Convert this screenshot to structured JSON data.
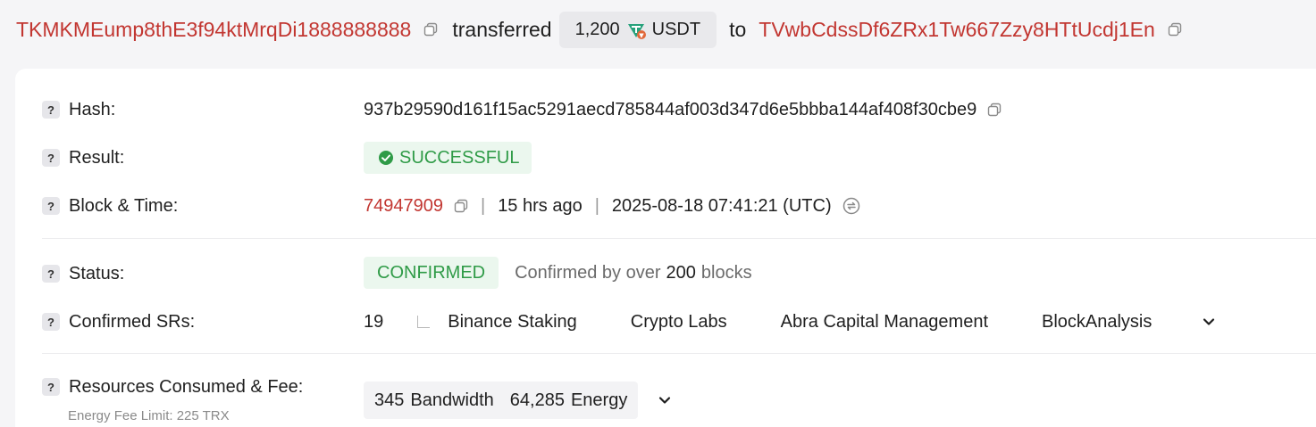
{
  "header": {
    "from_address": "TKMKMEump8thE3f94ktMrqDi1888888888",
    "transferred_word": "transferred",
    "amount": "1,200",
    "token_symbol": "USDT",
    "to_word": "to",
    "to_address": "TVwbCdssDf6ZRx1Tw667Zzy8HTtUcdj1En"
  },
  "hash": {
    "label": "Hash:",
    "value": "937b29590d161f15ac5291aecd785844af003d347d6e5bbba144af408f30cbe9"
  },
  "result": {
    "label": "Result:",
    "value": "SUCCESSFUL"
  },
  "block_time": {
    "label": "Block & Time:",
    "block": "74947909",
    "sep": "|",
    "age": "15 hrs ago",
    "datetime": "2025-08-18 07:41:21 (UTC)"
  },
  "status": {
    "label": "Status:",
    "value": "CONFIRMED",
    "confirmed_prefix": "Confirmed by over",
    "confirmed_count": "200",
    "confirmed_suffix": "blocks"
  },
  "confirmed_srs": {
    "label": "Confirmed SRs:",
    "count": "19",
    "names": [
      "Binance Staking",
      "Crypto Labs",
      "Abra Capital Management",
      "BlockAnalysis"
    ]
  },
  "resources": {
    "label": "Resources Consumed & Fee:",
    "sub_label": "Energy Fee Limit: 225 TRX",
    "bandwidth_value": "345",
    "bandwidth_label": "Bandwidth",
    "energy_value": "64,285",
    "energy_label": "Energy"
  },
  "colors": {
    "accent_red": "#c23631",
    "success_green": "#2f9b47",
    "success_bg": "#ebf7ee"
  },
  "icons": [
    "copy-icon",
    "usdt-token-icon",
    "check-circle-icon",
    "convert-time-icon",
    "chevron-down-icon",
    "help-icon"
  ]
}
